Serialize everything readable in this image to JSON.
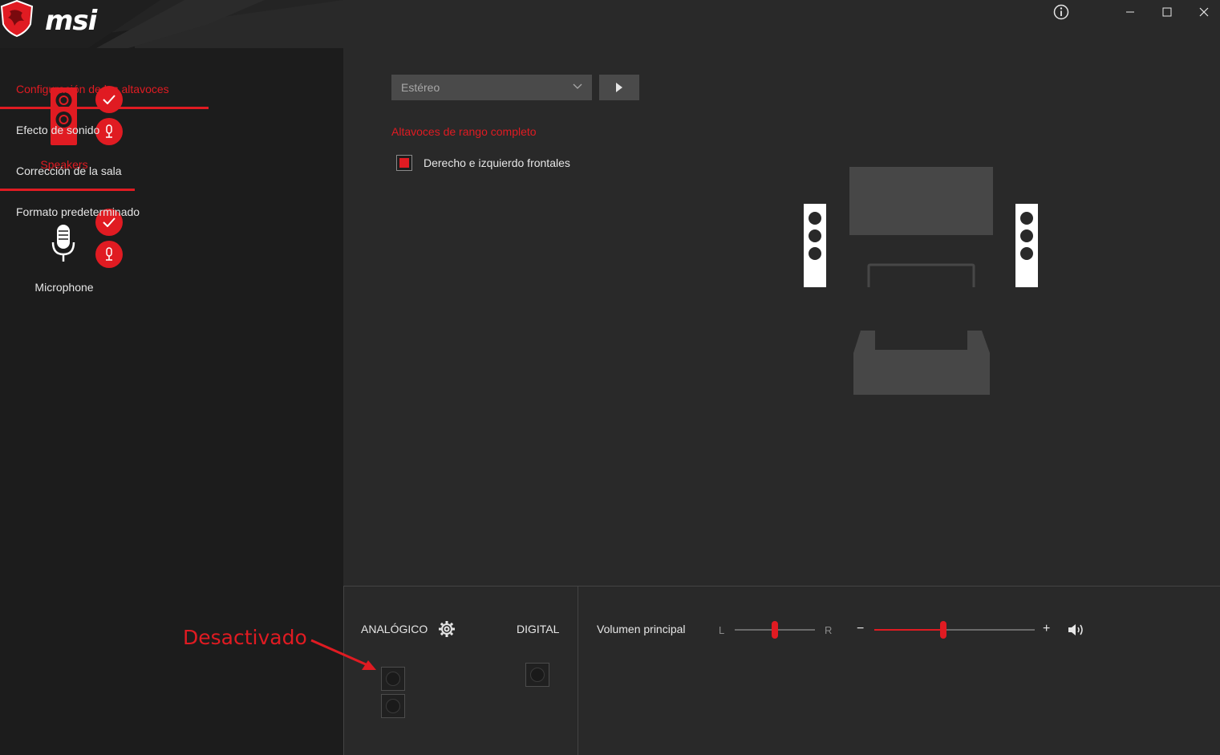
{
  "brand": {
    "logo_text": "msi"
  },
  "devices": [
    {
      "label": "Speakers",
      "active": true
    },
    {
      "label": "Microphone",
      "active": false
    }
  ],
  "menu": {
    "items": [
      {
        "label": "Configuración de los altavoces",
        "active": true
      },
      {
        "label": "Efecto de sonido",
        "active": false
      },
      {
        "label": "Corrección de la sala",
        "active": false
      },
      {
        "label": "Formato predeterminado",
        "active": false
      }
    ]
  },
  "window_controls": {
    "info": "info-icon",
    "minimize": "minimize-icon",
    "maximize": "maximize-icon",
    "close": "close-icon"
  },
  "speaker_config": {
    "dropdown_value": "Estéreo",
    "section_title": "Altavoces de rango completo",
    "checkbox_label": "Derecho e izquierdo frontales",
    "checkbox_checked": true
  },
  "bottom": {
    "analog_label": "ANALÓGICO",
    "digital_label": "DIGITAL",
    "volume_label": "Volumen principal",
    "balance_left": "L",
    "balance_right": "R",
    "volume_minus": "−",
    "volume_plus": "+",
    "balance_value_fraction": 0.5,
    "volume_value_fraction": 0.43
  },
  "annotation": {
    "text": "Desactivado"
  },
  "colors": {
    "accent": "#e01b22",
    "background": "#292929",
    "sidebar": "#1c1c1c"
  }
}
